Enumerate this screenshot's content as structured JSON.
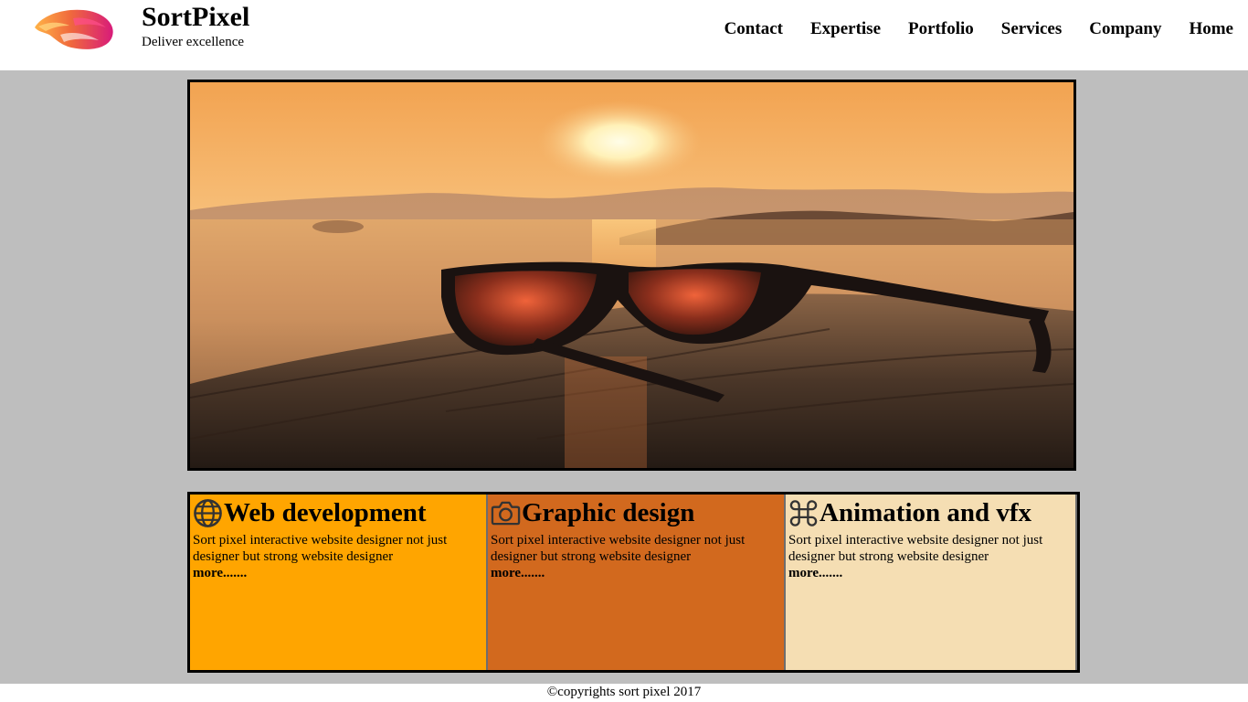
{
  "header": {
    "brand_name": "SortPixel",
    "tagline": "Deliver excellence",
    "nav": [
      "Contact",
      "Expertise",
      "Portfolio",
      "Services",
      "Company",
      "Home"
    ]
  },
  "hero": {
    "icon": "sunglasses-sunset-photo"
  },
  "services": [
    {
      "icon": "globe-icon",
      "title": "Web development",
      "text": "Sort pixel interactive website designer not just designer but strong website designer",
      "more": "more.......",
      "color": "#ffa500"
    },
    {
      "icon": "camera-icon",
      "title": "Graphic design",
      "text": "Sort pixel interactive website designer not just designer but strong website designer",
      "more": "more.......",
      "color": "#d2691e"
    },
    {
      "icon": "command-icon",
      "title": "Animation and vfx",
      "text": "Sort pixel interactive website designer not just designer but strong website designer",
      "more": "more.......",
      "color": "#f5deb3"
    }
  ],
  "footer": {
    "copyright": "©copyrights sort pixel 2017"
  }
}
